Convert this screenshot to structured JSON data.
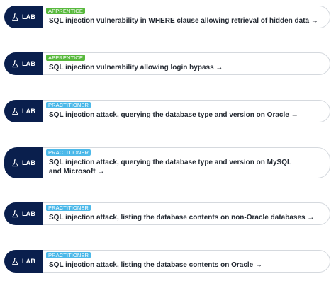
{
  "badge_label": "LAB",
  "labs": [
    {
      "level": "APPRENTICE",
      "title": "SQL injection vulnerability in WHERE clause allowing retrieval of hidden data →"
    },
    {
      "level": "APPRENTICE",
      "title": "SQL injection vulnerability allowing login bypass →"
    },
    {
      "level": "PRACTITIONER",
      "title": "SQL injection attack, querying the database type and version on Oracle →"
    },
    {
      "level": "PRACTITIONER",
      "title": "SQL injection attack, querying the database type and version on MySQL and Microsoft →"
    },
    {
      "level": "PRACTITIONER",
      "title": "SQL injection attack, listing the database contents on non-Oracle databases →"
    },
    {
      "level": "PRACTITIONER",
      "title": "SQL injection attack, listing the database contents on Oracle →"
    }
  ],
  "colors": {
    "badge_bg": "#0a1f4d",
    "apprentice": "#58b93d",
    "practitioner": "#4db9e9",
    "title_text": "#242a33",
    "card_border": "#d5d9de"
  },
  "icons": {
    "badge_icon": "flask-icon",
    "link_icon": "arrow-right-icon"
  }
}
